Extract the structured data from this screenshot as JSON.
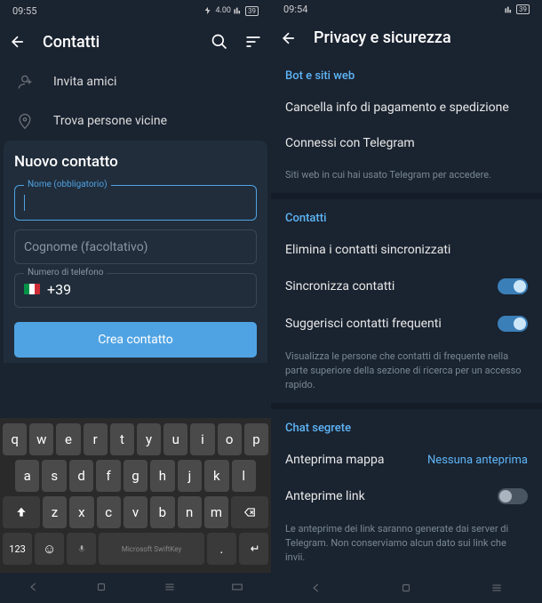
{
  "left": {
    "status": {
      "time": "09:55",
      "indicators": "📶 39"
    },
    "appbar": {
      "title": "Contatti"
    },
    "menu": {
      "invite": "Invita amici",
      "nearby": "Trova persone vicine"
    },
    "sheet": {
      "title": "Nuovo contatto",
      "name_label": "Nome (obbligatorio)",
      "surname_placeholder": "Cognome (facoltativo)",
      "phone_label": "Numero di telefono",
      "phone_value": "+39",
      "create": "Crea contatto"
    },
    "keyboard": {
      "row1": [
        "q",
        "w",
        "e",
        "r",
        "t",
        "y",
        "u",
        "i",
        "o",
        "p"
      ],
      "row2": [
        "a",
        "s",
        "d",
        "f",
        "g",
        "h",
        "j",
        "k",
        "l"
      ],
      "row3": [
        "z",
        "x",
        "c",
        "v",
        "b",
        "n",
        "m"
      ],
      "num": "123",
      "space": "Microsoft SwiftKey"
    }
  },
  "right": {
    "status": {
      "time": "09:54",
      "indicators": "📶 39"
    },
    "appbar": {
      "title": "Privacy e sicurezza"
    },
    "bots": {
      "title": "Bot e siti web",
      "payment": "Cancella info di pagamento e spedizione",
      "connected": "Connessi con Telegram",
      "hint": "Siti web in cui hai usato Telegram per accedere."
    },
    "contacts": {
      "title": "Contatti",
      "delete": "Elimina i contatti sincronizzati",
      "sync": "Sincronizza contatti",
      "suggest": "Suggerisci contatti frequenti",
      "hint": "Visualizza le persone che contatti di frequente nella parte superiore della sezione di ricerca per un accesso rapido."
    },
    "secret": {
      "title": "Chat segrete",
      "map": "Anteprima mappa",
      "map_val": "Nessuna anteprima",
      "link": "Anteprime link",
      "hint": "Le anteprime dei link saranno generate dai server di Telegram. Non conserviamo alcun dato sui link che invii."
    }
  }
}
